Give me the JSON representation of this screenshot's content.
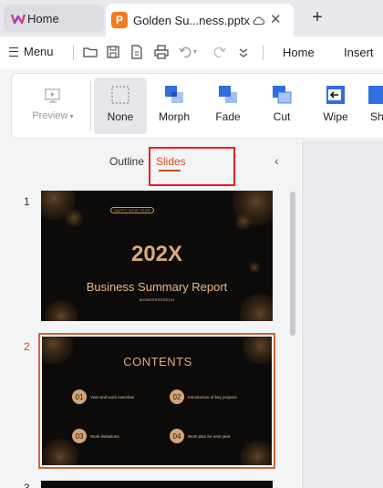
{
  "tabs": {
    "home_label": "Home",
    "doc_label": "Golden Su...ness.pptx",
    "doc_icon_letter": "P"
  },
  "menubar": {
    "menu_label": "Menu",
    "home_label": "Home",
    "insert_label": "Insert"
  },
  "ribbon": {
    "preview_label": "Preview",
    "transitions": [
      "None",
      "Morph",
      "Fade",
      "Cut",
      "Wipe",
      "Sh"
    ]
  },
  "panel": {
    "outline_label": "Outline",
    "slides_label": "Slides"
  },
  "slides": [
    {
      "number": "1",
      "badge": "HAPPY NEW YEAR",
      "year": "202X",
      "title": "Business Summary Report",
      "subtitle": "WONDERSOSECH"
    },
    {
      "number": "2",
      "title": "CONTENTS",
      "items": [
        {
          "num": "01",
          "text": "Year-end work overview"
        },
        {
          "num": "02",
          "text": "Introduction of key projects"
        },
        {
          "num": "03",
          "text": "Work limitations"
        },
        {
          "num": "04",
          "text": "Work plan for next year"
        }
      ]
    },
    {
      "number": "3"
    }
  ],
  "colors": {
    "accent": "#d6471f",
    "highlight": "#ee1c24",
    "gold": "#d9aa77",
    "slide_bg": "#0d0b09"
  }
}
